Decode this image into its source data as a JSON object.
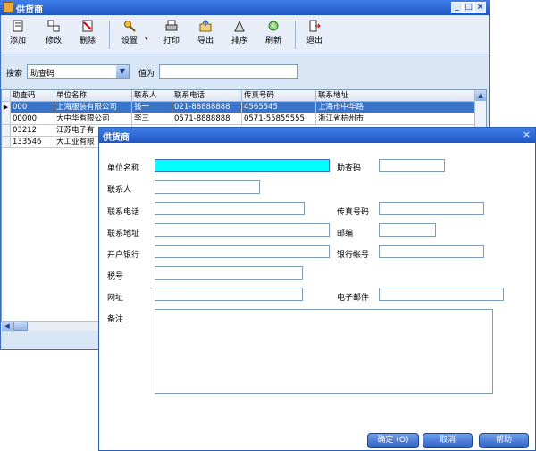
{
  "window": {
    "title": "供货商",
    "controls": [
      "_",
      "□",
      "×"
    ]
  },
  "toolbar": {
    "items": [
      {
        "label": "添加",
        "icon": "add-icon"
      },
      {
        "label": "修改",
        "icon": "edit-icon"
      },
      {
        "label": "删除",
        "icon": "delete-icon"
      },
      {
        "label": "设置",
        "icon": "settings-key-icon"
      },
      {
        "label": "打印",
        "icon": "print-icon"
      },
      {
        "label": "导出",
        "icon": "export-icon"
      },
      {
        "label": "排序",
        "icon": "sort-icon"
      },
      {
        "label": "刷新",
        "icon": "refresh-icon"
      },
      {
        "label": "退出",
        "icon": "exit-icon"
      }
    ]
  },
  "search": {
    "label": "搜索",
    "field_value": "助查码",
    "value_label": "值为",
    "value_input": ""
  },
  "grid": {
    "headers": [
      "助查码",
      "单位名称",
      "联系人",
      "联系电话",
      "传真号码",
      "联系地址"
    ],
    "rows": [
      [
        "000",
        "上海服装有限公司",
        "钱一",
        "021-88888888",
        "4565545",
        "上海市中华路"
      ],
      [
        "00000",
        "大中华有限公司",
        "李三",
        "0571-8888888",
        "0571-55855555",
        "浙江省杭州市"
      ],
      [
        "03212",
        "江苏电子有",
        "",
        "",
        "",
        ""
      ],
      [
        "133546",
        "大工业有限",
        "",
        "",
        "",
        ""
      ]
    ],
    "selected_row": 0
  },
  "dialog": {
    "title": "供货商",
    "close": "×",
    "fields": {
      "company_name": {
        "label": "单位名称",
        "value": ""
      },
      "help_code": {
        "label": "助查码",
        "value": ""
      },
      "contact": {
        "label": "联系人",
        "value": ""
      },
      "phone": {
        "label": "联系电话",
        "value": ""
      },
      "fax": {
        "label": "传真号码",
        "value": ""
      },
      "address": {
        "label": "联系地址",
        "value": ""
      },
      "postcode": {
        "label": "邮编",
        "value": ""
      },
      "bank": {
        "label": "开户银行",
        "value": ""
      },
      "bank_account": {
        "label": "银行帐号",
        "value": ""
      },
      "tax_no": {
        "label": "税号",
        "value": ""
      },
      "website": {
        "label": "网址",
        "value": ""
      },
      "email": {
        "label": "电子邮件",
        "value": ""
      },
      "notes": {
        "label": "备注",
        "value": ""
      }
    },
    "buttons": {
      "ok": "确定 (O)",
      "cancel": "取消",
      "help": "帮助"
    }
  },
  "colors": {
    "titlebar": "#1f55c4",
    "selection": "#3a74c8",
    "active_field": "#00ffff",
    "window_bg": "#d9e6f6"
  }
}
